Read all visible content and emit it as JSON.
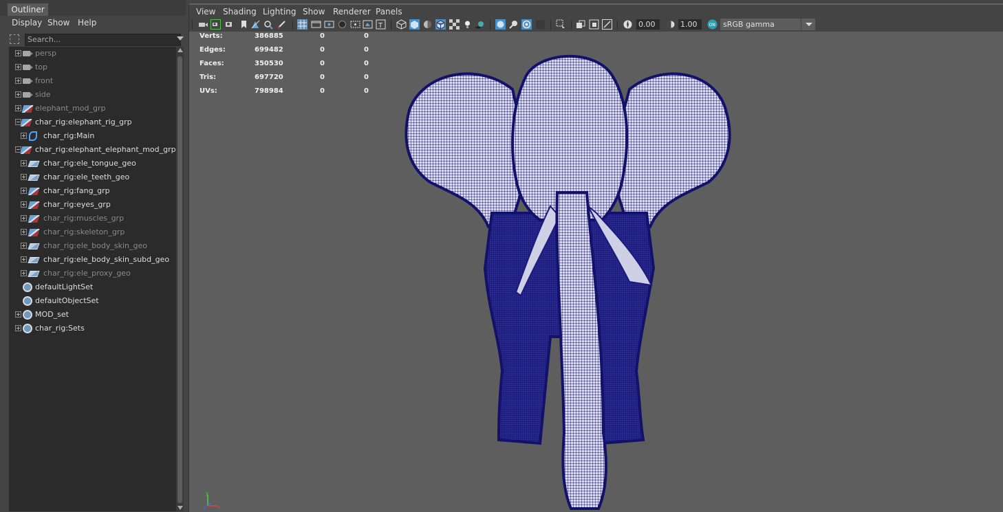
{
  "outliner": {
    "tab_label": "Outliner",
    "menu": [
      "Display",
      "Show",
      "Help"
    ],
    "search_placeholder": "Search...",
    "items": [
      {
        "label": "persp",
        "icon": "camera-icon",
        "dim": true
      },
      {
        "label": "top",
        "icon": "camera-icon",
        "dim": true
      },
      {
        "label": "front",
        "icon": "camera-icon",
        "dim": true
      },
      {
        "label": "side",
        "icon": "camera-icon",
        "dim": true
      },
      {
        "label": "elephant_mod_grp",
        "icon": "group-icon",
        "dim": true
      },
      {
        "label": "char_rig:elephant_rig_grp",
        "icon": "group-icon",
        "dim": false
      },
      {
        "label": "char_rig:Main",
        "icon": "curve-icon",
        "dim": false
      },
      {
        "label": "char_rig:elephant_elephant_mod_grp",
        "icon": "group-icon",
        "dim": false
      },
      {
        "label": "char_rig:ele_tongue_geo",
        "icon": "mesh-icon",
        "dim": false
      },
      {
        "label": "char_rig:ele_teeth_geo",
        "icon": "mesh-icon",
        "dim": false
      },
      {
        "label": "char_rig:fang_grp",
        "icon": "group-icon",
        "dim": false
      },
      {
        "label": "char_rig:eyes_grp",
        "icon": "group-icon",
        "dim": false
      },
      {
        "label": "char_rig:muscles_grp",
        "icon": "group-icon",
        "dim": true
      },
      {
        "label": "char_rig:skeleton_grp",
        "icon": "group-icon",
        "dim": true
      },
      {
        "label": "char_rig:ele_body_skin_geo",
        "icon": "mesh-icon",
        "dim": true
      },
      {
        "label": "char_rig:ele_body_skin_subd_geo",
        "icon": "mesh-icon",
        "dim": false
      },
      {
        "label": "char_rig:ele_proxy_geo",
        "icon": "mesh-icon",
        "dim": true
      },
      {
        "label": "defaultLightSet",
        "icon": "set-icon",
        "dim": false
      },
      {
        "label": "defaultObjectSet",
        "icon": "set-icon",
        "dim": false
      },
      {
        "label": "MOD_set",
        "icon": "set-icon",
        "dim": false
      },
      {
        "label": "char_rig:Sets",
        "icon": "set-icon",
        "dim": false
      }
    ]
  },
  "viewport": {
    "menu": [
      "View",
      "Shading",
      "Lighting",
      "Show",
      "Renderer",
      "Panels"
    ],
    "exposure": "0.00",
    "gamma": "1.00",
    "colorspace": "sRGB gamma",
    "hud": [
      {
        "label": "Verts:",
        "total": "386885",
        "sel": "0",
        "comp": "0"
      },
      {
        "label": "Edges:",
        "total": "699482",
        "sel": "0",
        "comp": "0"
      },
      {
        "label": "Faces:",
        "total": "350530",
        "sel": "0",
        "comp": "0"
      },
      {
        "label": "Tris:",
        "total": "697720",
        "sel": "0",
        "comp": "0"
      },
      {
        "label": "UVs:",
        "total": "798984",
        "sel": "0",
        "comp": "0"
      }
    ],
    "wireframe_color": "#1a1a80",
    "axis_labels": {
      "x": "x",
      "y": "y",
      "z": "z"
    }
  }
}
